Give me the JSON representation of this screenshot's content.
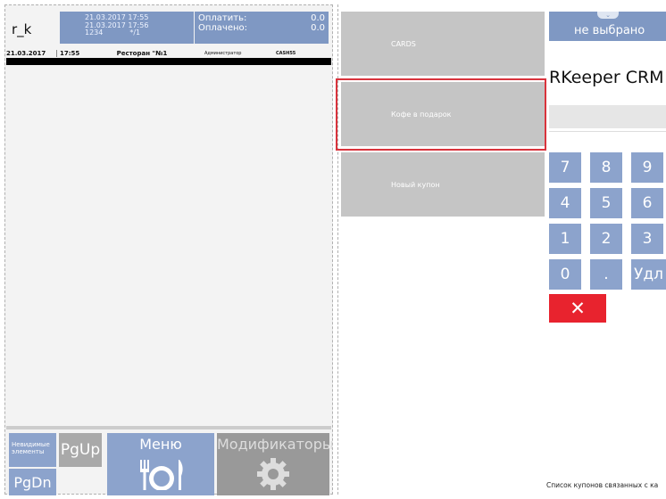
{
  "user": "r_k",
  "check": {
    "line1": "21.03.2017 17:55",
    "line2": "21.03.2017 17:56",
    "line3": "1234",
    "line3b": "*/1"
  },
  "payment": {
    "to_pay_label": "Оплатить:",
    "to_pay": "0.0",
    "paid_label": "Оплачено:",
    "paid": "0.0"
  },
  "header": {
    "date": "21.03.2017",
    "time": "17:55",
    "restaurant": "Ресторан \"№1",
    "role": "Администратор",
    "station": "CASH55"
  },
  "buttons": {
    "invisible": "Невидимые элементы",
    "pgup": "PgUp",
    "pgdn": "PgDn",
    "menu": "Меню",
    "modifiers": "Модификаторы"
  },
  "coupons": [
    {
      "label": "CARDS"
    },
    {
      "label": "Кофе в подарок"
    },
    {
      "label": "Новый купон"
    }
  ],
  "crm": {
    "not_selected": "не выбрано",
    "title": "RKeeper CRM"
  },
  "keypad": [
    "7",
    "8",
    "9",
    "4",
    "5",
    "6",
    "1",
    "2",
    "3",
    "0",
    ".",
    "Удл"
  ],
  "close_symbol": "✕",
  "footer": "Список купонов связанных с ка",
  "colors": {
    "blue": "#8ca3cc",
    "grey": "#c5c5c5",
    "red": "#e8232e"
  }
}
